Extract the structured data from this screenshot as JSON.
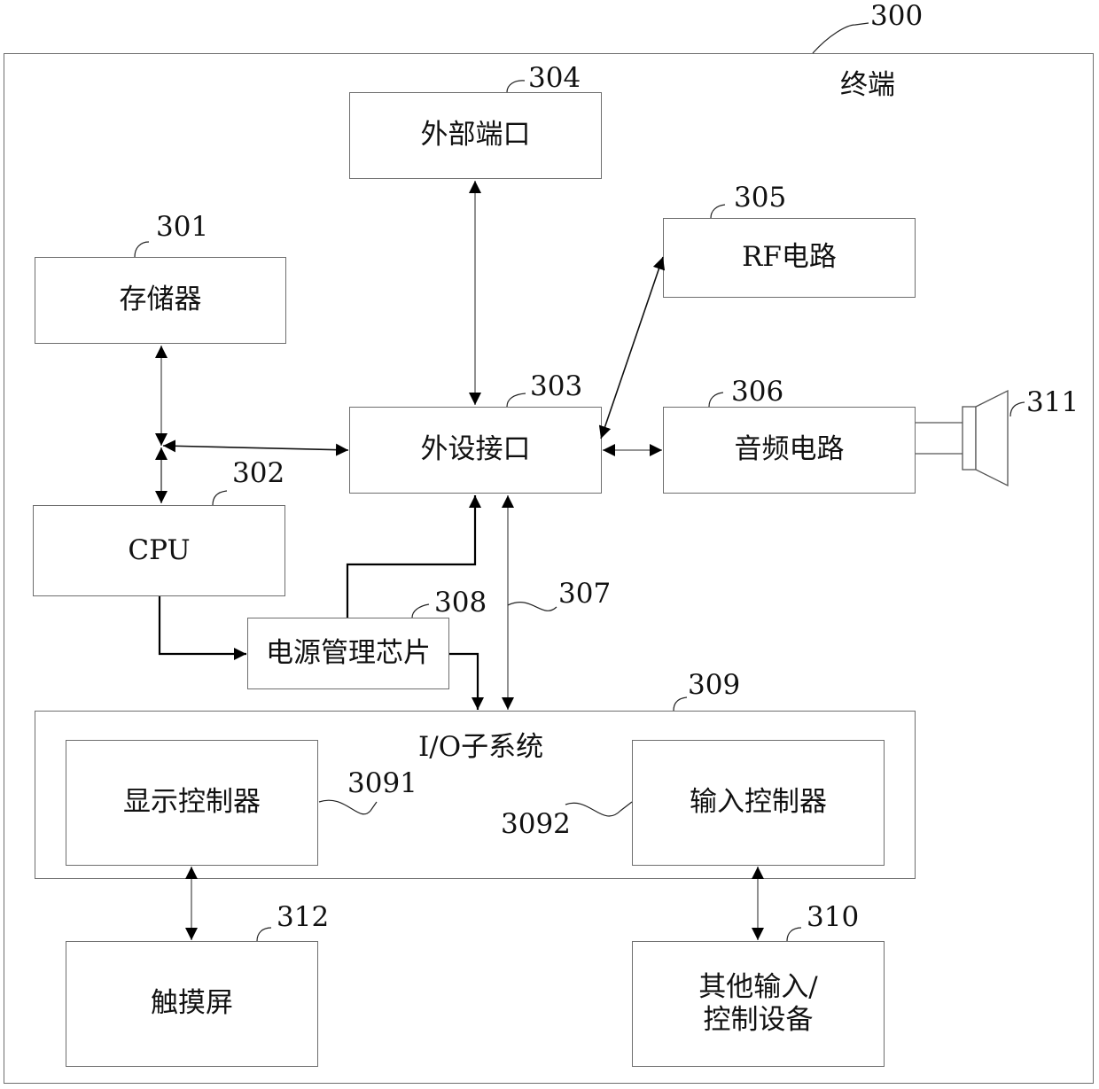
{
  "terminal": {
    "label": "终端",
    "ref": "300"
  },
  "blocks": {
    "memory": {
      "label": "存储器",
      "ref": "301"
    },
    "cpu": {
      "label": "CPU",
      "ref": "302"
    },
    "peripheral_interface": {
      "label": "外设接口",
      "ref": "303"
    },
    "external_port": {
      "label": "外部端口",
      "ref": "304"
    },
    "rf_circuit": {
      "label": "RF电路",
      "ref": "305"
    },
    "audio_circuit": {
      "label": "音频电路",
      "ref": "306"
    },
    "bus": {
      "ref": "307"
    },
    "power_management_chip": {
      "label": "电源管理芯片",
      "ref": "308"
    },
    "io_subsystem": {
      "label": "I/O子系统",
      "ref": "309"
    },
    "display_controller": {
      "label": "显示控制器",
      "ref": "3091"
    },
    "input_controller": {
      "label": "输入控制器",
      "ref": "3092"
    },
    "other_input_control_devices": {
      "label": "其他输入/控制设备",
      "ref": "310"
    },
    "speaker": {
      "ref": "311"
    },
    "touch_screen": {
      "label": "触摸屏",
      "ref": "312"
    }
  },
  "colors": {
    "line": "#000000",
    "border": "#6e6e6e",
    "background": "#ffffff"
  }
}
